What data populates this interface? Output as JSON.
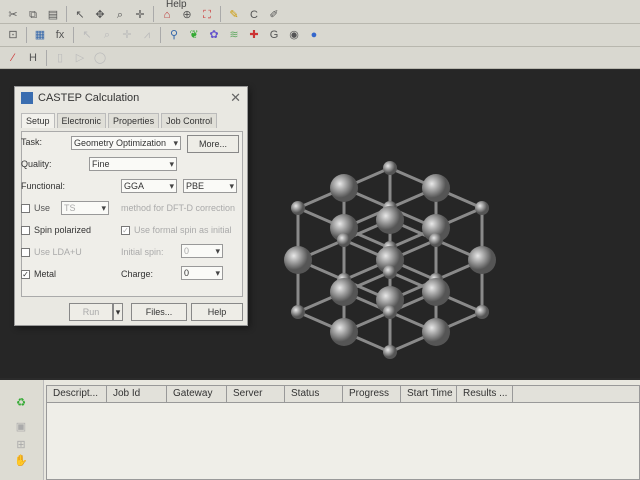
{
  "menu": {
    "help": "Help"
  },
  "dialog": {
    "title": "CASTEP Calculation",
    "tabs": [
      "Setup",
      "Electronic",
      "Properties",
      "Job Control"
    ],
    "task_label": "Task:",
    "task_value": "Geometry Optimization",
    "more_button": "More...",
    "quality_label": "Quality:",
    "quality_value": "Fine",
    "functional_label": "Functional:",
    "functional_value": "GGA",
    "functional_sub": "PBE",
    "use_label": "Use",
    "dftd_value": "TS",
    "dftd_text": "method for DFT-D correction",
    "spin_polarized": "Spin polarized",
    "formal_spin": "Use formal spin as initial",
    "lda_u": "Use LDA+U",
    "initial_spin_label": "Initial spin:",
    "initial_spin_value": "0",
    "metal": "Metal",
    "charge_label": "Charge:",
    "charge_value": "0",
    "run_button": "Run",
    "files_button": "Files...",
    "help_button": "Help"
  },
  "jobs": {
    "columns": [
      "Descript...",
      "Job Id",
      "Gateway",
      "Server",
      "Status",
      "Progress",
      "Start Time",
      "Results ..."
    ]
  }
}
